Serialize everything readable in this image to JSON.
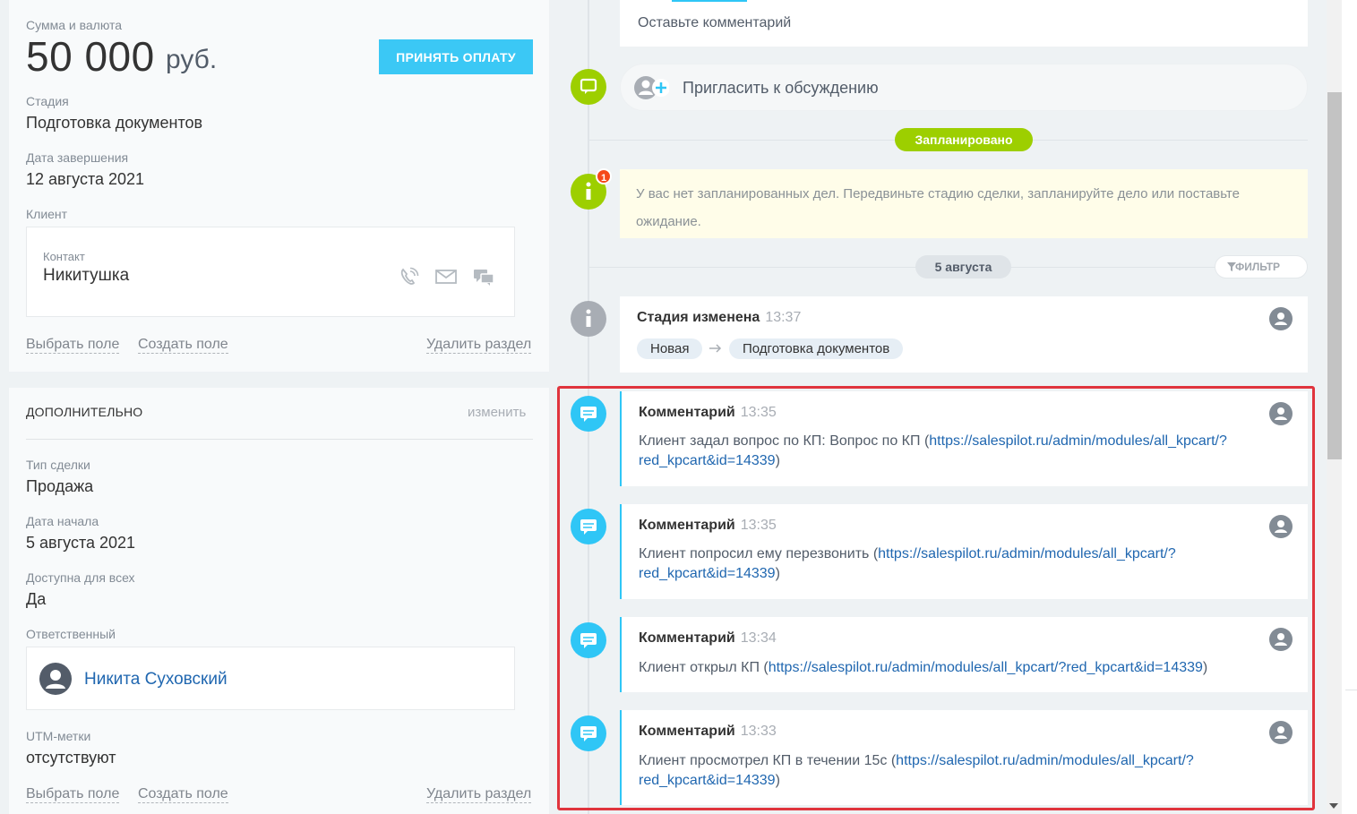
{
  "deal": {
    "amount_label": "Сумма и валюта",
    "amount": "50 000",
    "currency": "руб.",
    "accept_payment_label": "ПРИНЯТЬ ОПЛАТУ",
    "stage_label": "Стадия",
    "stage": "Подготовка документов",
    "close_date_label": "Дата завершения",
    "close_date": "12 августа 2021",
    "client_label": "Клиент",
    "contact_label": "Контакт",
    "contact_name": "Никитушка",
    "links": {
      "choose_field": "Выбрать поле",
      "create_field": "Создать поле",
      "delete_section": "Удалить раздел"
    }
  },
  "additional": {
    "title": "ДОПОЛНИТЕЛЬНО",
    "edit_label": "изменить",
    "deal_type_label": "Тип сделки",
    "deal_type": "Продажа",
    "start_date_label": "Дата начала",
    "start_date": "5 августа 2021",
    "available_label": "Доступна для всех",
    "available": "Да",
    "responsible_label": "Ответственный",
    "responsible_name": "Никита Суховский",
    "utm_label": "UTM-метки",
    "utm_value": "отсутствуют",
    "links": {
      "choose_field": "Выбрать поле",
      "create_field": "Создать поле",
      "delete_section": "Удалить раздел"
    }
  },
  "timeline": {
    "comment_placeholder": "Оставьте комментарий",
    "invite_label": "Пригласить к обсуждению",
    "planned_label": "Запланировано",
    "notice_badge": "1",
    "notice_text": "У вас нет запланированных дел. Передвиньте стадию сделки, запланируйте дело или поставьте ожидание.",
    "date_label": "5 августа",
    "filter_label": "ФИЛЬТР",
    "stage_change": {
      "title": "Стадия изменена",
      "time": "13:37",
      "from": "Новая",
      "to": "Подготовка документов"
    },
    "comments": [
      {
        "title": "Комментарий",
        "time": "13:35",
        "text": "Клиент задал вопрос по КП: Вопрос по КП (",
        "link_part1": "https://salespilot.ru/admin/modules/all_kpcart/?",
        "link_part2": "red_kpcart&id=14339",
        "tail": ")"
      },
      {
        "title": "Комментарий",
        "time": "13:35",
        "text": "Клиент попросил ему перезвонить (",
        "link_part1": "https://salespilot.ru/admin/modules/all_kpcart/?",
        "link_part2": "red_kpcart&id=14339",
        "tail": ")"
      },
      {
        "title": "Комментарий",
        "time": "13:34",
        "text": "Клиент открыл КП (",
        "link_part1": "https://salespilot.ru/admin/modules/all_kpcart/?red_kpcart&id=14339",
        "link_part2": "",
        "tail": ")"
      },
      {
        "title": "Комментарий",
        "time": "13:33",
        "text": "Клиент просмотрел КП в течении 15с (",
        "link_part1": "https://salespilot.ru/admin/modules/all_kpcart/?",
        "link_part2": "red_kpcart&id=14339",
        "tail": ")"
      }
    ]
  },
  "colors": {
    "accent_blue": "#3bc8f5",
    "green": "#9dcf00",
    "comment_blue": "#2fc6f6",
    "link": "#2067b0",
    "highlight_red": "#e0343d",
    "badge_red": "#f54819"
  },
  "icons": [
    "phone-icon",
    "mail-icon",
    "chat-icon",
    "chat-bubble-icon",
    "info-icon",
    "comment-icon",
    "user-avatar-icon",
    "add-user-icon",
    "filter-icon",
    "arrow-right-icon"
  ]
}
